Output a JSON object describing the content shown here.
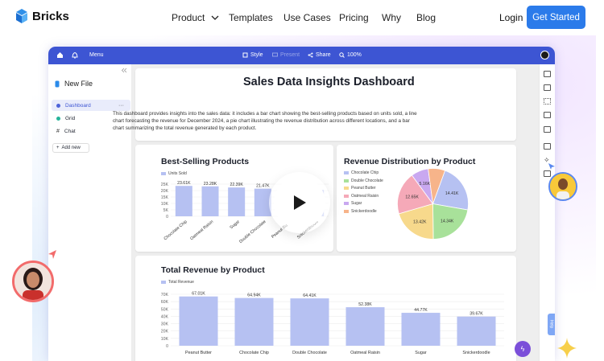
{
  "nav": {
    "brand": "Bricks",
    "items": [
      "Product",
      "Templates",
      "Use Cases",
      "Pricing",
      "Why",
      "Blog"
    ],
    "login": "Login",
    "cta": "Get Started"
  },
  "toolbar": {
    "menu": "Menu",
    "style": "Style",
    "present": "Present",
    "share": "Share",
    "zoom": "100%"
  },
  "sidebar": {
    "file": "New File",
    "items": [
      "Dashboard",
      "Grid",
      "Chat"
    ],
    "add": "Add new"
  },
  "dashboard": {
    "title": "Sales Data Insights Dashboard",
    "description_lines": [
      "This dashboard provides insights into the sales data: it includes a bar chart showing the best-selling products based on units sold, a line",
      "chart forecasting the revenue for December 2024, a pie chart illustrating the revenue distribution across different locations, and a bar",
      "chart summarizing the total revenue generated by each product."
    ]
  },
  "help": "Help",
  "colors": {
    "accent": "#3d55d3",
    "bar": "#b6c1f2",
    "cta": "#2b7bea"
  },
  "chart_data": [
    {
      "type": "bar",
      "title": "Best-Selling Products",
      "legend": [
        "Units Sold"
      ],
      "categories": [
        "Chocolate Chip",
        "Oatmeal Raisin",
        "Sugar",
        "Double Chocolate",
        "Peanut Butter",
        "Snickerdoodle"
      ],
      "values": [
        23610,
        23280,
        22390,
        21470,
        21000,
        20500
      ],
      "data_labels": [
        "23.61K",
        "23.28K",
        "22.39K",
        "21.47K",
        "",
        ""
      ],
      "yticks": [
        "25K",
        "20K",
        "15K",
        "10K",
        "5K",
        "0"
      ],
      "ylim": [
        0,
        25000
      ]
    },
    {
      "type": "pie",
      "title": "Revenue Distribution by Product",
      "legend": [
        "Chocolate Chip",
        "Double Chocolate",
        "Peanut Butter",
        "Oatmeal Raisin",
        "Sugar",
        "Snickerdoodle"
      ],
      "colors": [
        "#b6c1f2",
        "#a8e19a",
        "#f7d98c",
        "#f5a9b8",
        "#c9a8f0",
        "#f7b48a"
      ],
      "values": [
        14.41,
        14.34,
        13.42,
        12.65,
        5.16,
        5.0
      ],
      "data_labels": [
        "14.41K",
        "14.34K",
        "13.42K",
        "12.65K",
        "5.16K",
        ""
      ]
    },
    {
      "type": "bar",
      "title": "Total Revenue by Product",
      "legend": [
        "Total Revenue"
      ],
      "categories": [
        "Peanut Butter",
        "Chocolate Chip",
        "Double Chocolate",
        "Oatmeal Raisin",
        "Sugar",
        "Snickerdoodle"
      ],
      "values": [
        67010,
        64940,
        64410,
        52380,
        44770,
        39670
      ],
      "data_labels": [
        "67.01K",
        "64.94K",
        "64.41K",
        "52.38K",
        "44.77K",
        "39.67K"
      ],
      "yticks": [
        "70K",
        "60K",
        "50K",
        "40K",
        "30K",
        "20K",
        "10K",
        "0"
      ],
      "ylim": [
        0,
        70000
      ]
    }
  ]
}
